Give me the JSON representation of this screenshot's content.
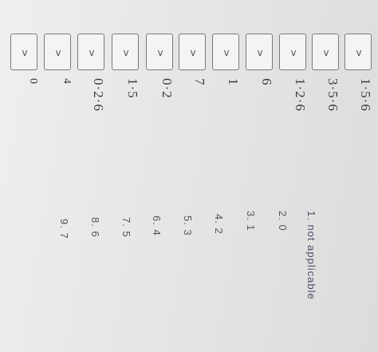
{
  "rows": [
    {
      "value": "1·5·6"
    },
    {
      "value": "3·5·6"
    },
    {
      "value": "1·2·6"
    },
    {
      "value": "6"
    },
    {
      "value": "1"
    },
    {
      "value": "7"
    },
    {
      "value": "0·2"
    },
    {
      "value": "1·5"
    },
    {
      "value": "0·2·6"
    },
    {
      "value": "4"
    },
    {
      "value": "0"
    }
  ],
  "dropdown_glyph": "v",
  "choices": [
    {
      "label": "1.  not applicable"
    },
    {
      "label": "2. 0"
    },
    {
      "label": "3. 1"
    },
    {
      "label": "4. 2"
    },
    {
      "label": "5. 3"
    },
    {
      "label": "6. 4"
    },
    {
      "label": "7. 5"
    },
    {
      "label": "8. 6"
    },
    {
      "label": "9. 7"
    }
  ]
}
